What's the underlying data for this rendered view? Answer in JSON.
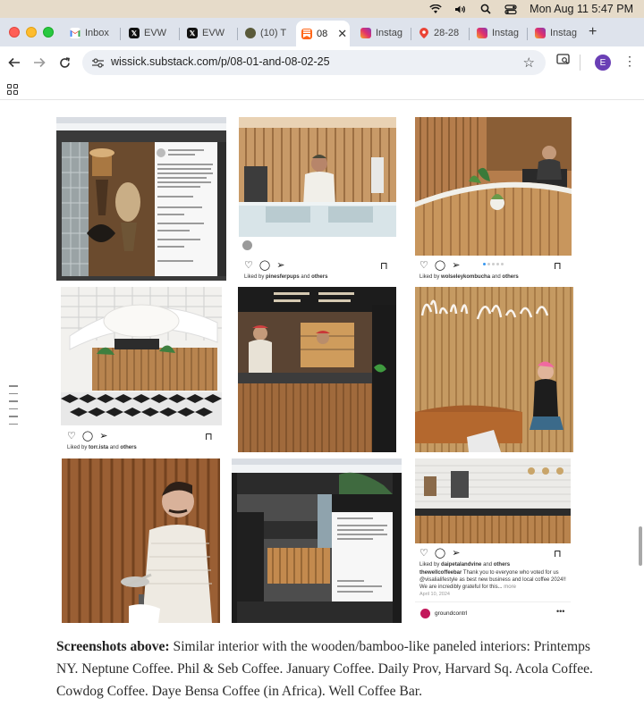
{
  "menubar": {
    "datetime": "Mon Aug 11  5:47 PM"
  },
  "tabs": [
    {
      "label": "Inbox",
      "icon": "gmail-icon"
    },
    {
      "label": "EVW",
      "icon": "x-icon"
    },
    {
      "label": "EVW",
      "icon": "x-icon"
    },
    {
      "label": "(10) T",
      "icon": "site-icon"
    },
    {
      "label": "08",
      "icon": "substack-icon",
      "active": true
    },
    {
      "label": "Instag",
      "icon": "instagram-icon"
    },
    {
      "label": "28-28",
      "icon": "maps-icon"
    },
    {
      "label": "Instag",
      "icon": "instagram-icon"
    },
    {
      "label": "Instag",
      "icon": "instagram-icon"
    }
  ],
  "toolbar": {
    "url": "wissick.substack.com/p/08-01-and-08-02-25",
    "avatar_letter": "E"
  },
  "posts": {
    "liked_by_1": "pinesferpups",
    "liked_by_2": "wolseleykombucha",
    "liked_by_3": "torr.ista",
    "liked_by_4": "daipetalandvine",
    "liked_prefix": "Liked by",
    "liked_suffix": "and",
    "others": "others",
    "caption_user": "thewellcoffeebar",
    "caption_text": "Thank you to everyone who voted for us @visalialifestyle as best new business and local coffee 2024!! We are incredibly grateful for this...",
    "more": "more",
    "date": "April 10, 2024",
    "profile_name": "groundcontrl"
  },
  "article": {
    "caption_lead": "Screenshots above:",
    "caption_body": " Similar interior with the wooden/bamboo-like paneled interiors: Printemps NY. Neptune Coffee. Phil & Seb Coffee. January Coffee. Daily Prov, Harvard Sq. Acola Coffee. Cowdog Coffee. Daye Bensa Coffee (in Africa). Well Coffee Bar."
  },
  "colors": {
    "wood": "#b07a46",
    "wood_dark": "#8a5a2e",
    "menubar": "#e6dbc9",
    "tabstrip": "#dee3ec"
  }
}
